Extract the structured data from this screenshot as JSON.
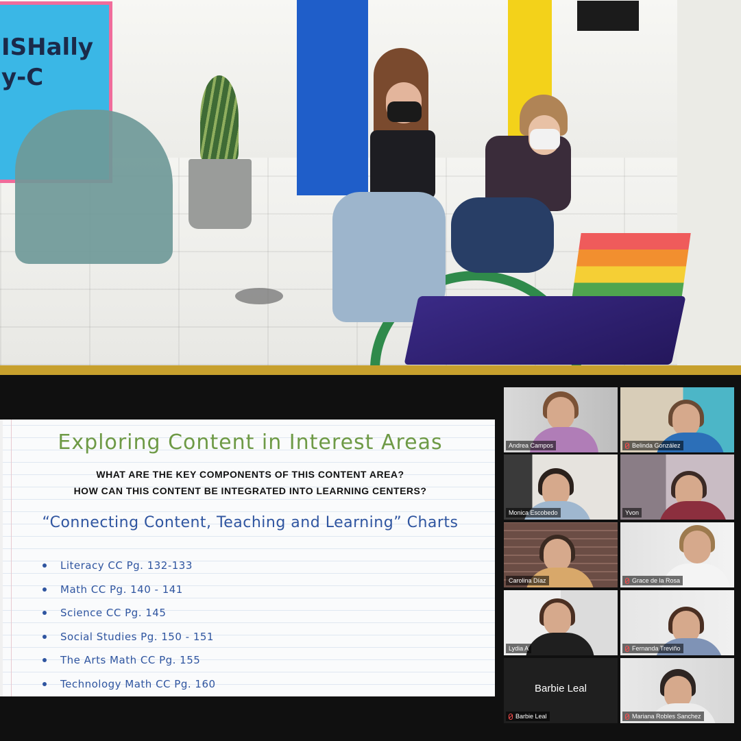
{
  "photo": {
    "mural_text": "ISHally\ny-C"
  },
  "slide": {
    "title": "Exploring Content in Interest Areas",
    "question_1": "WHAT ARE THE KEY COMPONENTS OF THIS CONTENT AREA?",
    "question_2": "HOW CAN THIS CONTENT BE INTEGRATED INTO LEARNING CENTERS?",
    "subtitle": "“Connecting Content, Teaching and Learning” Charts",
    "items": [
      "Literacy CC Pg. 132-133",
      "Math CC Pg. 140 - 141",
      "Science CC Pg. 145",
      "Social Studies Pg. 150 - 151",
      "The Arts Math CC Pg. 155",
      "Technology Math CC Pg. 160"
    ]
  },
  "participants": [
    {
      "name": "Andrea Campos",
      "muted": false
    },
    {
      "name": "Belinda González",
      "muted": true
    },
    {
      "name": "Monica Escobedo",
      "muted": false
    },
    {
      "name": "Yvon",
      "muted": false,
      "active_speaker": true
    },
    {
      "name": "Carolina Díaz",
      "muted": false
    },
    {
      "name": "Grace de la Rosa",
      "muted": true
    },
    {
      "name": "Lydia A",
      "muted": false
    },
    {
      "name": "Fernanda Treviño",
      "muted": true
    },
    {
      "name": "Barbie Leal",
      "muted": true,
      "video_off": true
    },
    {
      "name": "Mariana Robles Sanchez",
      "muted": true
    }
  ],
  "colors": {
    "slide_title": "#6e9a46",
    "slide_text": "#2f55a0",
    "active_speaker_border": "#e3dc76",
    "muted_icon": "#ff4c4c",
    "divider_bar": "#c7a02d"
  }
}
